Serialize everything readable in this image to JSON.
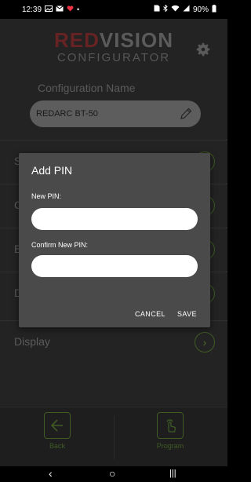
{
  "status_bar": {
    "time": "12:39",
    "left_icons": [
      "image-icon",
      "mail-icon",
      "heart-icon"
    ],
    "right_icons": [
      "sim-icon",
      "bluetooth-icon",
      "wifi-icon",
      "signal-icon"
    ],
    "battery": "90%"
  },
  "header": {
    "logo_red": "RED",
    "logo_main": "VISION",
    "logo_sub": "CONFIGURATOR"
  },
  "config": {
    "label": "Configuration Name",
    "value": "REDARC BT-50"
  },
  "menu": {
    "items": [
      {
        "label": "S"
      },
      {
        "label": "C"
      },
      {
        "label": "E"
      },
      {
        "label": "D"
      },
      {
        "label": "Display"
      }
    ],
    "arrow_glyph": "›"
  },
  "bottom": {
    "back_label": "Back",
    "program_label": "Program"
  },
  "dialog": {
    "title": "Add PIN",
    "new_pin_label": "New PIN:",
    "new_pin_value": "",
    "confirm_pin_label": "Confirm New PIN:",
    "confirm_pin_value": "",
    "cancel_label": "CANCEL",
    "save_label": "SAVE"
  },
  "nav": {
    "back": "‹",
    "home": "○",
    "recents": "|||"
  },
  "colors": {
    "accent_green": "#4b6b2a",
    "dialog_bg": "#4a4a4a",
    "app_bg": "#2a2a2a"
  }
}
